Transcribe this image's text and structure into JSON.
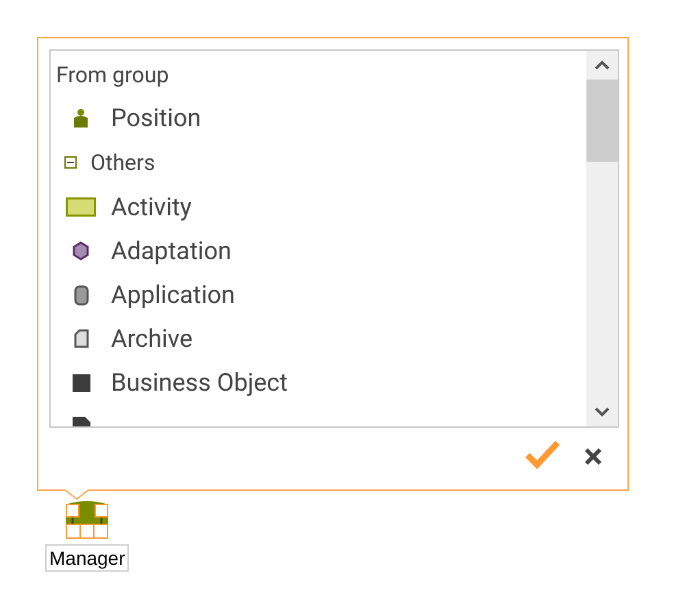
{
  "popup": {
    "list": {
      "items": [
        {
          "kind": "header",
          "label": "From group"
        },
        {
          "kind": "position",
          "label": "Position"
        },
        {
          "kind": "group",
          "label": "Others",
          "expanded": true
        },
        {
          "kind": "activity",
          "label": "Activity"
        },
        {
          "kind": "adaptation",
          "label": "Adaptation"
        },
        {
          "kind": "application",
          "label": "Application"
        },
        {
          "kind": "archive",
          "label": "Archive"
        },
        {
          "kind": "business-object",
          "label": "Business Object"
        },
        {
          "kind": "document"
        }
      ]
    }
  },
  "node": {
    "label": "Manager"
  }
}
